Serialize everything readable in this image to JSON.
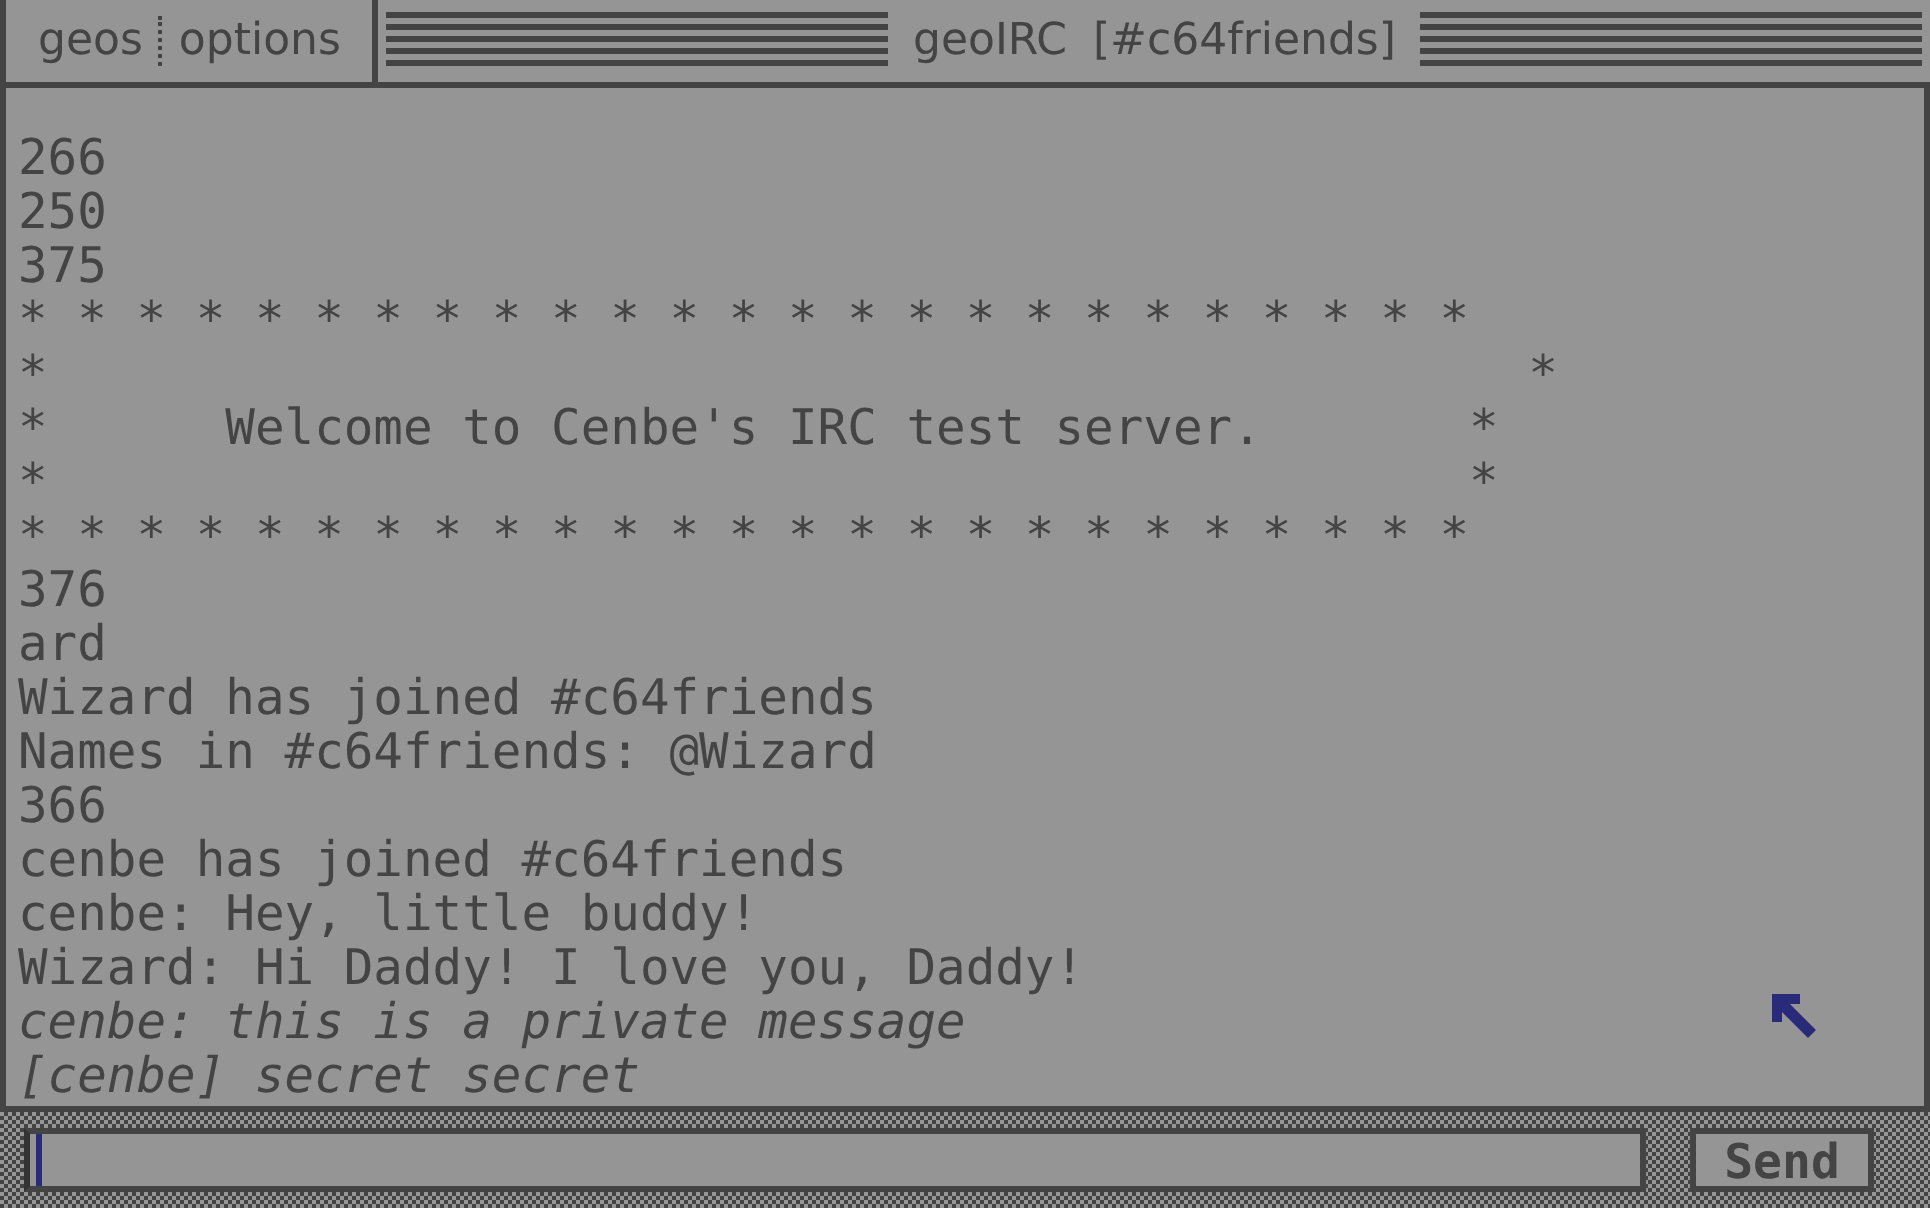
{
  "menu": [
    {
      "label": "geos"
    },
    {
      "label": "options"
    }
  ],
  "window": {
    "title": "geoIRC [#c64friends]"
  },
  "messages": [
    {
      "kind": "plain",
      "text": "266"
    },
    {
      "kind": "plain",
      "text": "250"
    },
    {
      "kind": "plain",
      "text": "375"
    },
    {
      "kind": "plain",
      "text": "* * * * * * * * * * * * * * * * * * * * * * * * *"
    },
    {
      "kind": "plain",
      "text": "*                                                  *"
    },
    {
      "kind": "plain",
      "text": "*      Welcome to Cenbe's IRC test server.       *"
    },
    {
      "kind": "plain",
      "text": "*                                                *"
    },
    {
      "kind": "plain",
      "text": "* * * * * * * * * * * * * * * * * * * * * * * * *"
    },
    {
      "kind": "plain",
      "text": "376"
    },
    {
      "kind": "plain",
      "text": "ard"
    },
    {
      "kind": "plain",
      "text": "Wizard has joined #c64friends"
    },
    {
      "kind": "plain",
      "text": "Names in #c64friends: @Wizard"
    },
    {
      "kind": "plain",
      "text": "366"
    },
    {
      "kind": "plain",
      "text": "cenbe has joined #c64friends"
    },
    {
      "kind": "plain",
      "text": "cenbe: Hey, little buddy!"
    },
    {
      "kind": "plain",
      "text": "Wizard: Hi Daddy! I love you, Daddy!"
    },
    {
      "kind": "private",
      "text": "cenbe: this is a private message"
    },
    {
      "kind": "private",
      "text": "[cenbe] secret secret"
    }
  ],
  "send_button": {
    "label": "Send"
  }
}
